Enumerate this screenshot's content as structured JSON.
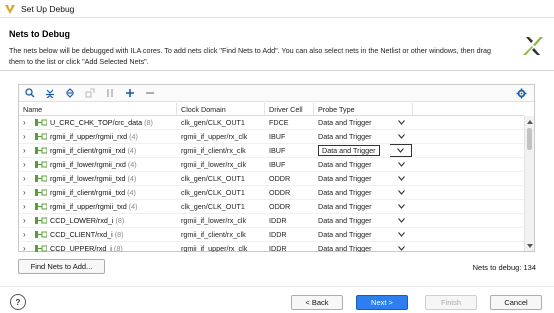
{
  "window": {
    "title": "Set Up Debug"
  },
  "header": {
    "heading": "Nets to Debug",
    "description": "The nets below will be debugged with ILA cores. To add nets click \"Find Nets to Add\". You can also select nets in the Netlist or other windows, then drag them to the list or click \"Add Selected Nets\"."
  },
  "toolbar": {
    "icons": [
      "search-icon",
      "collapse-all-icon",
      "expand-all-icon",
      "move-icon",
      "pause-icon",
      "add-icon",
      "remove-icon",
      "settings-icon"
    ]
  },
  "table": {
    "columns": [
      "Name",
      "Clock Domain",
      "Driver Cell",
      "Probe Type"
    ],
    "rows": [
      {
        "name": "U_CRC_CHK_TOP/crc_data",
        "count": "(8)",
        "clock": "clk_gen/CLK_OUT1",
        "driver": "FDCE",
        "probe": "Data and Trigger"
      },
      {
        "name": "rgmii_if_upper/rgmii_rxd",
        "count": "(4)",
        "clock": "rgmii_if_upper/rx_clk",
        "driver": "IBUF",
        "probe": "Data and Trigger"
      },
      {
        "name": "rgmii_if_client/rgmii_rxd",
        "count": "(4)",
        "clock": "rgmii_if_client/rx_clk",
        "driver": "IBUF",
        "probe": "Data and Trigger"
      },
      {
        "name": "rgmii_if_lower/rgmii_rxd",
        "count": "(4)",
        "clock": "rgmii_if_lower/rx_clk",
        "driver": "IBUF",
        "probe": "Data and Trigger"
      },
      {
        "name": "rgmii_if_lower/rgmii_txd",
        "count": "(4)",
        "clock": "clk_gen/CLK_OUT1",
        "driver": "ODDR",
        "probe": "Data and Trigger"
      },
      {
        "name": "rgmii_if_client/rgmii_txd",
        "count": "(4)",
        "clock": "clk_gen/CLK_OUT1",
        "driver": "ODDR",
        "probe": "Data and Trigger"
      },
      {
        "name": "rgmii_if_upper/rgmii_txd",
        "count": "(4)",
        "clock": "clk_gen/CLK_OUT1",
        "driver": "ODDR",
        "probe": "Data and Trigger"
      },
      {
        "name": "CCD_LOWER/rxd_i",
        "count": "(8)",
        "clock": "rgmii_if_lower/rx_clk",
        "driver": "IDDR",
        "probe": "Data and Trigger"
      },
      {
        "name": "CCD_CLIENT/rxd_i",
        "count": "(8)",
        "clock": "rgmii_if_client/rx_clk",
        "driver": "IDDR",
        "probe": "Data and Trigger"
      },
      {
        "name": "CCD_UPPER/rxd_i",
        "count": "(8)",
        "clock": "rgmii_if_upper/rx_clk",
        "driver": "IDDR",
        "probe": "Data and Trigger"
      }
    ],
    "selected_row_index": 2
  },
  "find_nets_button": "Find Nets to Add...",
  "nets_to_debug": "Nets to debug: 134",
  "footer": {
    "help": "?",
    "back": "< Back",
    "next": "Next >",
    "finish": "Finish",
    "cancel": "Cancel"
  },
  "colors": {
    "primary_button": "#2d7ff0",
    "accent_logo": "#d6a928"
  }
}
